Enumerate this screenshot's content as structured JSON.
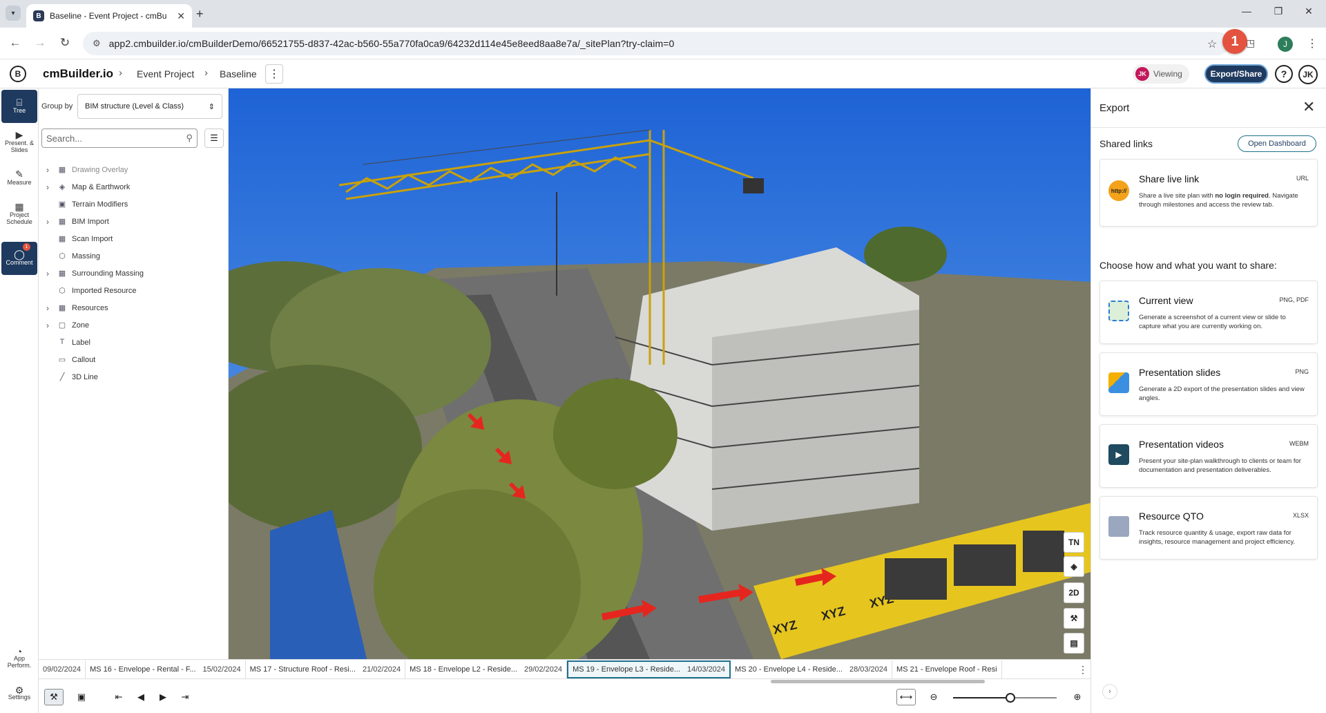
{
  "browser": {
    "tab_title": "Baseline - Event Project - cmBu",
    "url": "app2.cmbuilder.io/cmBuilderDemo/66521755-d837-42ac-b560-55a770fa0ca9/64232d114e45e8eed8aa8e7a/_sitePlan?try-claim=0",
    "profile_initial": "J",
    "annotation_number": "1"
  },
  "header": {
    "app_name": "cmBuilder.io",
    "breadcrumb": [
      "Event Project",
      "Baseline"
    ],
    "viewing_initials": "JK",
    "viewing_label": "Viewing",
    "export_label": "Export/Share",
    "help_label": "?",
    "user_initials": "JK"
  },
  "rail": {
    "items": [
      {
        "label": "Tree",
        "icon": "tree-icon"
      },
      {
        "label": "Present. & Slides",
        "icon": "presentation-icon"
      },
      {
        "label": "Measure",
        "icon": "ruler-icon"
      },
      {
        "label": "Project Schedule",
        "icon": "schedule-icon"
      },
      {
        "label": "Comment",
        "icon": "comment-icon",
        "badge": "1"
      }
    ],
    "bottom": [
      {
        "label": "App Perform.",
        "icon": "performance-icon"
      },
      {
        "label": "Settings",
        "icon": "gear-icon"
      }
    ]
  },
  "tree": {
    "groupby_label": "Group by",
    "groupby_value": "BIM structure (Level & Class)",
    "search_placeholder": "Search...",
    "items": [
      {
        "label": "Drawing Overlay",
        "expandable": true
      },
      {
        "label": "Map & Earthwork",
        "expandable": true
      },
      {
        "label": "Terrain Modifiers",
        "expandable": false
      },
      {
        "label": "BIM Import",
        "expandable": true
      },
      {
        "label": "Scan Import",
        "expandable": false
      },
      {
        "label": "Massing",
        "expandable": false
      },
      {
        "label": "Surrounding Massing",
        "expandable": true
      },
      {
        "label": "Imported Resource",
        "expandable": false
      },
      {
        "label": "Resources",
        "expandable": true
      },
      {
        "label": "Zone",
        "expandable": true
      },
      {
        "label": "Label",
        "expandable": false
      },
      {
        "label": "Callout",
        "expandable": false
      },
      {
        "label": "3D Line",
        "expandable": false
      }
    ]
  },
  "viewport": {
    "buttons": [
      "TN",
      "layers",
      "2D",
      "crane",
      "legend"
    ],
    "hoarding_text": "XYZ"
  },
  "milestones": [
    {
      "date": "09/02/2024",
      "label": ""
    },
    {
      "label": "MS 16 -  Envelope - Rental - F...",
      "date": "15/02/2024"
    },
    {
      "label": "MS 17 -  Structure Roof - Resi...",
      "date": "21/02/2024"
    },
    {
      "label": "MS 18 -  Envelope L2 - Reside...",
      "date": "29/02/2024"
    },
    {
      "label": "MS 19 -  Envelope L3 - Reside...",
      "date": "14/03/2024",
      "active": true
    },
    {
      "label": "MS 20 -  Envelope L4 - Reside...",
      "date": "28/03/2024"
    },
    {
      "label": "MS 21 -  Envelope Roof - Resi",
      "date": ""
    }
  ],
  "playback": {
    "zoom_level": 0.55
  },
  "export": {
    "title": "Export",
    "shared_links_label": "Shared links",
    "open_dashboard_label": "Open Dashboard",
    "share_card": {
      "title": "Share live link",
      "format": "URL",
      "desc_pre": "Share a live site plan with ",
      "desc_bold": "no login required",
      "desc_post": ". Navigate through milestones and access the review tab."
    },
    "choose_label": "Choose how and what you want to share:",
    "cards": [
      {
        "title": "Current view",
        "format": "PNG, PDF",
        "desc": "Generate a screenshot of a current view or slide to capture what you are currently working on."
      },
      {
        "title": "Presentation slides",
        "format": "PNG",
        "desc": "Generate a 2D export of the presentation slides and view angles."
      },
      {
        "title": "Presentation videos",
        "format": "WEBM",
        "desc": "Present your site-plan walkthrough to clients or team for documentation and presentation deliverables."
      },
      {
        "title": "Resource QTO",
        "format": "XLSX",
        "desc": "Track resource quantity & usage, export raw data for insights, resource management and project efficiency."
      }
    ]
  },
  "colors": {
    "accent": "#1f3a5f",
    "badge": "#e3533f",
    "sky": "#2f6fd4"
  }
}
